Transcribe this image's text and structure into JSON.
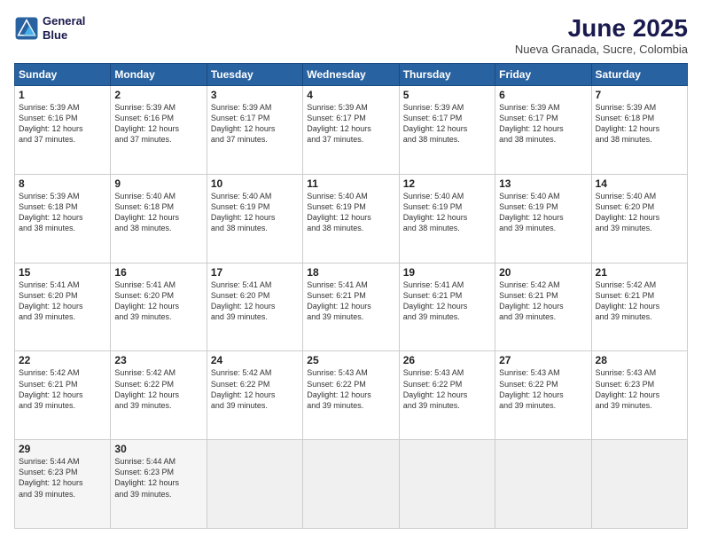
{
  "logo": {
    "line1": "General",
    "line2": "Blue"
  },
  "title": "June 2025",
  "subtitle": "Nueva Granada, Sucre, Colombia",
  "days_header": [
    "Sunday",
    "Monday",
    "Tuesday",
    "Wednesday",
    "Thursday",
    "Friday",
    "Saturday"
  ],
  "weeks": [
    [
      {
        "day": "1",
        "text": "Sunrise: 5:39 AM\nSunset: 6:16 PM\nDaylight: 12 hours\nand 37 minutes."
      },
      {
        "day": "2",
        "text": "Sunrise: 5:39 AM\nSunset: 6:16 PM\nDaylight: 12 hours\nand 37 minutes."
      },
      {
        "day": "3",
        "text": "Sunrise: 5:39 AM\nSunset: 6:17 PM\nDaylight: 12 hours\nand 37 minutes."
      },
      {
        "day": "4",
        "text": "Sunrise: 5:39 AM\nSunset: 6:17 PM\nDaylight: 12 hours\nand 37 minutes."
      },
      {
        "day": "5",
        "text": "Sunrise: 5:39 AM\nSunset: 6:17 PM\nDaylight: 12 hours\nand 38 minutes."
      },
      {
        "day": "6",
        "text": "Sunrise: 5:39 AM\nSunset: 6:17 PM\nDaylight: 12 hours\nand 38 minutes."
      },
      {
        "day": "7",
        "text": "Sunrise: 5:39 AM\nSunset: 6:18 PM\nDaylight: 12 hours\nand 38 minutes."
      }
    ],
    [
      {
        "day": "8",
        "text": "Sunrise: 5:39 AM\nSunset: 6:18 PM\nDaylight: 12 hours\nand 38 minutes."
      },
      {
        "day": "9",
        "text": "Sunrise: 5:40 AM\nSunset: 6:18 PM\nDaylight: 12 hours\nand 38 minutes."
      },
      {
        "day": "10",
        "text": "Sunrise: 5:40 AM\nSunset: 6:19 PM\nDaylight: 12 hours\nand 38 minutes."
      },
      {
        "day": "11",
        "text": "Sunrise: 5:40 AM\nSunset: 6:19 PM\nDaylight: 12 hours\nand 38 minutes."
      },
      {
        "day": "12",
        "text": "Sunrise: 5:40 AM\nSunset: 6:19 PM\nDaylight: 12 hours\nand 38 minutes."
      },
      {
        "day": "13",
        "text": "Sunrise: 5:40 AM\nSunset: 6:19 PM\nDaylight: 12 hours\nand 39 minutes."
      },
      {
        "day": "14",
        "text": "Sunrise: 5:40 AM\nSunset: 6:20 PM\nDaylight: 12 hours\nand 39 minutes."
      }
    ],
    [
      {
        "day": "15",
        "text": "Sunrise: 5:41 AM\nSunset: 6:20 PM\nDaylight: 12 hours\nand 39 minutes."
      },
      {
        "day": "16",
        "text": "Sunrise: 5:41 AM\nSunset: 6:20 PM\nDaylight: 12 hours\nand 39 minutes."
      },
      {
        "day": "17",
        "text": "Sunrise: 5:41 AM\nSunset: 6:20 PM\nDaylight: 12 hours\nand 39 minutes."
      },
      {
        "day": "18",
        "text": "Sunrise: 5:41 AM\nSunset: 6:21 PM\nDaylight: 12 hours\nand 39 minutes."
      },
      {
        "day": "19",
        "text": "Sunrise: 5:41 AM\nSunset: 6:21 PM\nDaylight: 12 hours\nand 39 minutes."
      },
      {
        "day": "20",
        "text": "Sunrise: 5:42 AM\nSunset: 6:21 PM\nDaylight: 12 hours\nand 39 minutes."
      },
      {
        "day": "21",
        "text": "Sunrise: 5:42 AM\nSunset: 6:21 PM\nDaylight: 12 hours\nand 39 minutes."
      }
    ],
    [
      {
        "day": "22",
        "text": "Sunrise: 5:42 AM\nSunset: 6:21 PM\nDaylight: 12 hours\nand 39 minutes."
      },
      {
        "day": "23",
        "text": "Sunrise: 5:42 AM\nSunset: 6:22 PM\nDaylight: 12 hours\nand 39 minutes."
      },
      {
        "day": "24",
        "text": "Sunrise: 5:42 AM\nSunset: 6:22 PM\nDaylight: 12 hours\nand 39 minutes."
      },
      {
        "day": "25",
        "text": "Sunrise: 5:43 AM\nSunset: 6:22 PM\nDaylight: 12 hours\nand 39 minutes."
      },
      {
        "day": "26",
        "text": "Sunrise: 5:43 AM\nSunset: 6:22 PM\nDaylight: 12 hours\nand 39 minutes."
      },
      {
        "day": "27",
        "text": "Sunrise: 5:43 AM\nSunset: 6:22 PM\nDaylight: 12 hours\nand 39 minutes."
      },
      {
        "day": "28",
        "text": "Sunrise: 5:43 AM\nSunset: 6:23 PM\nDaylight: 12 hours\nand 39 minutes."
      }
    ],
    [
      {
        "day": "29",
        "text": "Sunrise: 5:44 AM\nSunset: 6:23 PM\nDaylight: 12 hours\nand 39 minutes."
      },
      {
        "day": "30",
        "text": "Sunrise: 5:44 AM\nSunset: 6:23 PM\nDaylight: 12 hours\nand 39 minutes."
      },
      {
        "day": "",
        "text": ""
      },
      {
        "day": "",
        "text": ""
      },
      {
        "day": "",
        "text": ""
      },
      {
        "day": "",
        "text": ""
      },
      {
        "day": "",
        "text": ""
      }
    ]
  ]
}
